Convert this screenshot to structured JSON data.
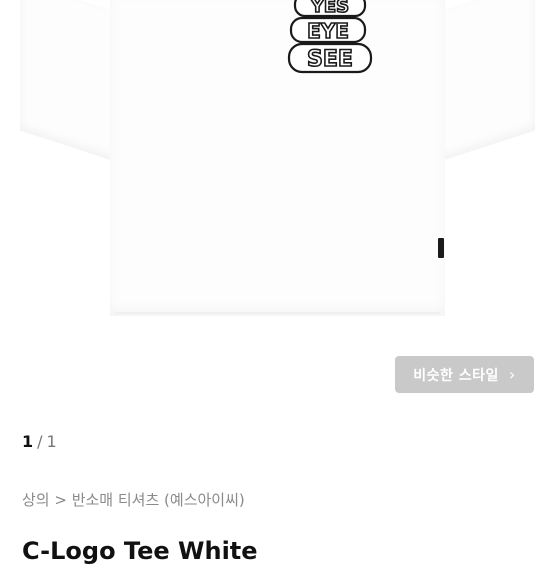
{
  "product": {
    "logo_words": [
      "YES",
      "EYE",
      "SEE"
    ],
    "title": "C-Logo Tee White"
  },
  "similar_button": {
    "label": "비슷한 스타일",
    "icon": "chevron-right-icon"
  },
  "pagination": {
    "current": "1",
    "separator": "/",
    "total": "1"
  },
  "breadcrumb": {
    "text": "상의 > 반소매 티셔츠 (예스아이씨)"
  },
  "colors": {
    "button_bg": "#c9c9c9",
    "button_text": "#ffffff",
    "breadcrumb_text": "#8a8a8a",
    "title_text": "#111111"
  }
}
